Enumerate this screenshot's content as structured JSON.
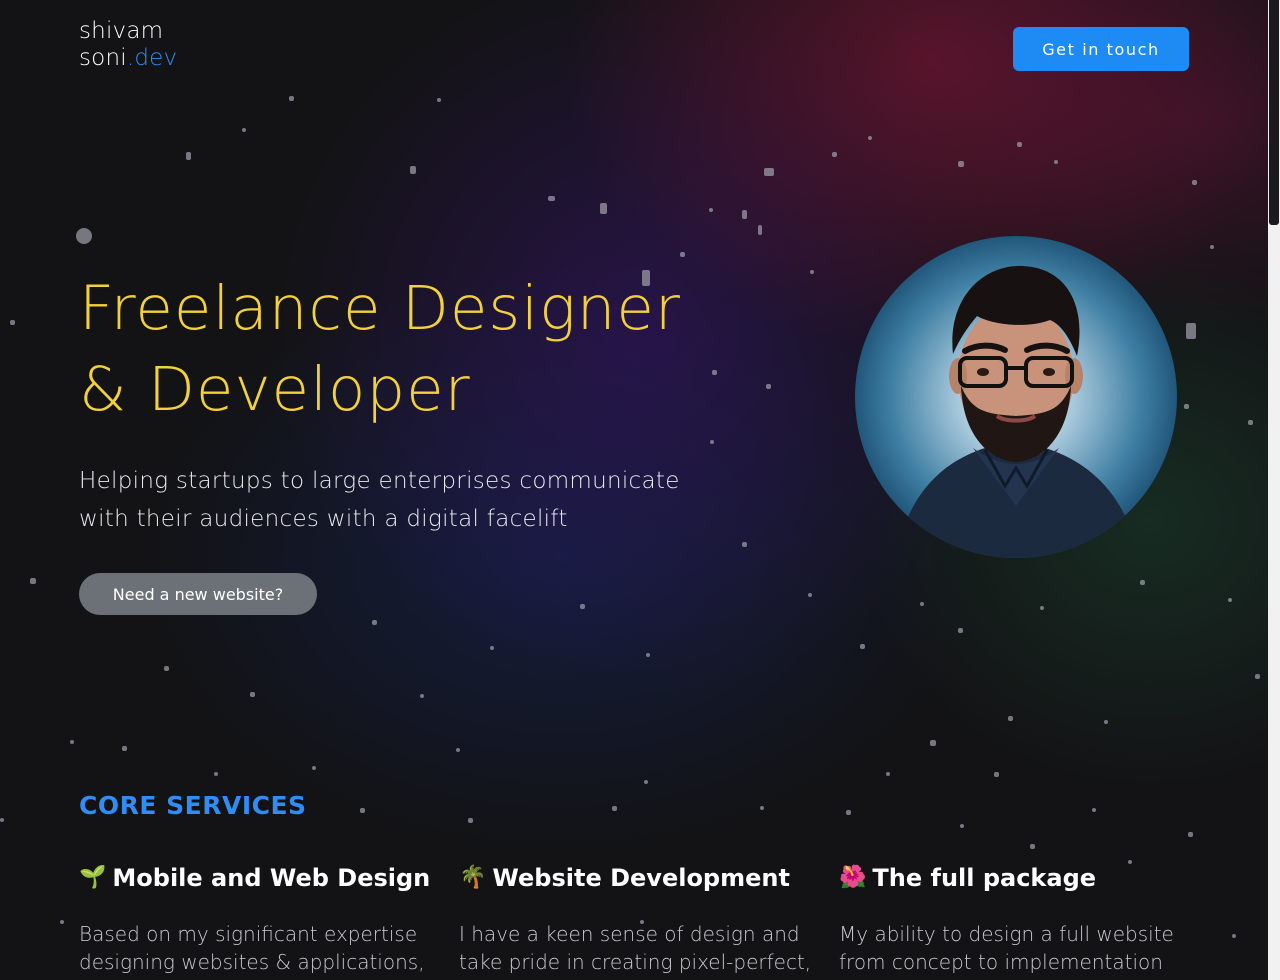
{
  "header": {
    "logo_line1": "shivam",
    "logo_line2_main": "soni",
    "logo_line2_accent": ".dev",
    "cta_label": "Get in touch"
  },
  "hero": {
    "headline_line1": "Freelance Designer",
    "headline_line2": "& Developer",
    "subhead_line1": "Helping startups to large enterprises communicate",
    "subhead_line2": "with their audiences with a digital facelift",
    "button_label": "Need a new website?"
  },
  "services": {
    "title": "CORE SERVICES",
    "items": [
      {
        "emoji": "🌱",
        "title": "Mobile and Web Design",
        "desc_line1": "Based on my significant expertise",
        "desc_line2": "designing websites & applications,"
      },
      {
        "emoji": "🌴",
        "title": "Website Development",
        "desc_line1": "I have a keen sense of design and",
        "desc_line2": "take pride in creating pixel-perfect,"
      },
      {
        "emoji": "🌺",
        "title": "The full package",
        "desc_line1": "My ability to design a full website",
        "desc_line2": "from concept to implementation"
      }
    ]
  },
  "colors": {
    "accent_blue": "#1e8bf5",
    "headline_yellow": "#f2d13a",
    "background": "#131315"
  }
}
